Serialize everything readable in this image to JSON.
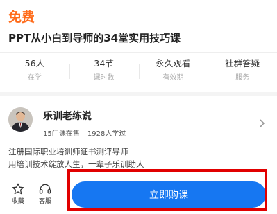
{
  "header": {
    "price": "免费",
    "title": "PPT从小白到导师的34堂实用技巧课"
  },
  "stats": [
    {
      "value": "56人",
      "label": "在学"
    },
    {
      "value": "34节",
      "label": "课时数"
    },
    {
      "value": "永久观看",
      "label": "有效期"
    },
    {
      "value": "社群答疑",
      "label": "服务"
    }
  ],
  "teacher": {
    "name": "乐训老练说",
    "courses": "15门课在售",
    "students": "1928人学过",
    "bio_line1": "注册国际职业培训师证书测评导师",
    "bio_line2": "用培训技术绽放人生，一辈子乐训助人"
  },
  "bottom": {
    "favorite_label": "收藏",
    "service_label": "客服",
    "buy_label": "立即购课"
  },
  "colors": {
    "price": "#ff6b1a",
    "primary": "#1677f2",
    "highlight": "#e10000"
  }
}
